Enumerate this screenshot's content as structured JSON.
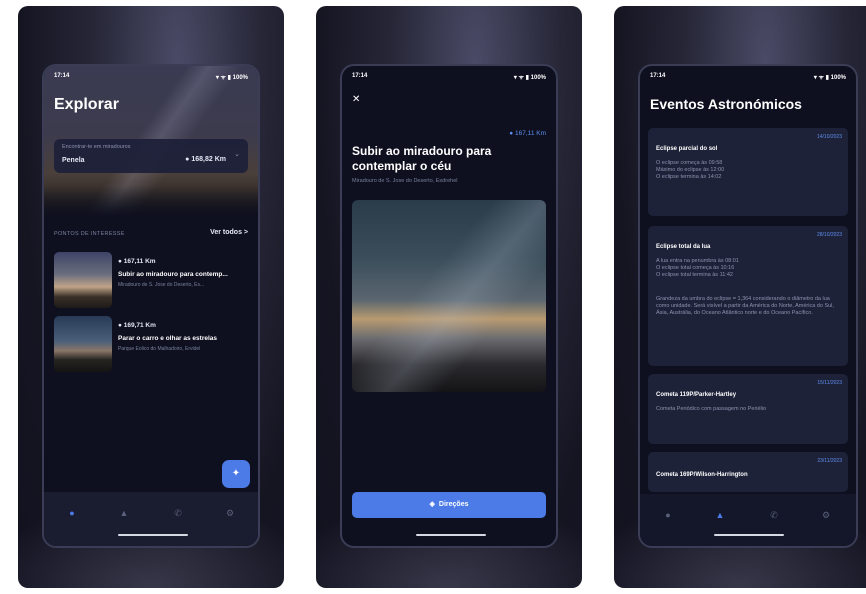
{
  "status": {
    "time": "17:14",
    "icons": "▾ ᯤ ▮ 100%"
  },
  "explore": {
    "title": "Explorar",
    "location_label": "Encontrar-te em miradouros",
    "location_value": "Penela",
    "location_distance": "168,82 Km",
    "section_title": "PONTOS DE INTERESSE",
    "see_all": "Ver todos >",
    "poi": [
      {
        "distance": "167,11 Km",
        "title": "Subir ao miradouro para contemp...",
        "subtitle": "Miradouro de S. Jose do Deserto, Es..."
      },
      {
        "distance": "169,71 Km",
        "title": "Parar o carro e olhar as estrelas",
        "subtitle": "Parque Eolico do Malhadoiro, Ervidel"
      }
    ]
  },
  "detail": {
    "distance": "167,11 Km",
    "title": "Subir ao miradouro para contemplar o céu",
    "subtitle": "Miradouro de S. Jose do Deserto, Esdrehel",
    "button": "Direções"
  },
  "events": {
    "title": "Eventos Astronómicos",
    "items": [
      {
        "date": "14/10/2023",
        "name": "Eclipse parcial do sol",
        "desc": [
          "O eclipse começa às 09:58",
          "Máximo do eclipse às 12:00",
          "O eclipse termina às 14:02"
        ],
        "extra": ""
      },
      {
        "date": "28/10/2023",
        "name": "Eclipse total da lua",
        "desc": [
          "A lua entra na penumbra às 08:01",
          "O eclipse total começa às 10:16",
          "O eclipse total termina às 11:42"
        ],
        "extra": "Grandeza da umbra do eclipse = 1,364 considerando o diâmetro da lua como unidade. Será visível a partir da América do Norte, América do Sul, Ásia, Austrália, do Oceano Atlântico norte e do Oceano Pacífico."
      },
      {
        "date": "15/11/2023",
        "name": "Cometa 119P/Parker-Hartley",
        "desc": [
          "Cometa Periódico com passagem no Periélio"
        ],
        "extra": ""
      },
      {
        "date": "23/11/2023",
        "name": "Cometa 169P/Wilson-Harrington",
        "desc": [],
        "extra": ""
      }
    ]
  },
  "nav": {
    "icons": [
      "compass-icon",
      "mountain-icon",
      "phone-icon",
      "gear-icon"
    ]
  },
  "colors": {
    "accent": "#4c7be8",
    "background": "#0e1020",
    "card": "#1e2238"
  }
}
